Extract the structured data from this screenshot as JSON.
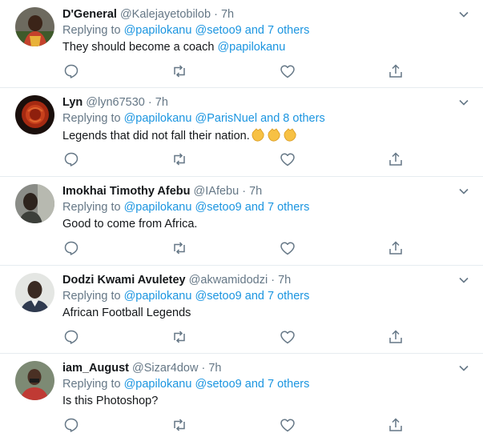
{
  "replying_label": "Replying to",
  "colors": {
    "link": "#1b95e0",
    "muted": "#657786",
    "text": "#14171a",
    "divider": "#e6ecf0"
  },
  "tweets": [
    {
      "name": "D'General",
      "handle": "@Kalejayetobilob",
      "dot": "·",
      "time": "7h",
      "reply_mention": "@papilokanu",
      "reply_rest": "@setoo9 and 7 others",
      "text": "They should become a coach",
      "text_mention": "@papilokanu"
    },
    {
      "name": "Lyn",
      "handle": "@lyn67530",
      "dot": "·",
      "time": "7h",
      "reply_mention": "@papilokanu",
      "reply_rest": "@ParisNuel and 8 others",
      "text": "Legends that did not fall their nation.",
      "emoji": "clapping-hands-icon ×3"
    },
    {
      "name": "Imokhai Timothy Afebu",
      "handle": "@IAfebu",
      "dot": "·",
      "time": "7h",
      "reply_mention": "@papilokanu",
      "reply_rest": "@setoo9 and 7 others",
      "text": "Good to come from Africa."
    },
    {
      "name": "Dodzi Kwami Avuletey",
      "handle": "@akwamidodzi",
      "dot": "·",
      "time": "7h",
      "reply_mention": "@papilokanu",
      "reply_rest": "@setoo9 and 7 others",
      "text": "African Football Legends"
    },
    {
      "name": "iam_August",
      "handle": "@Sizar4dow",
      "dot": "·",
      "time": "7h",
      "reply_mention": "@papilokanu",
      "reply_rest": "@setoo9 and 7 others",
      "text": "Is this Photoshop?"
    }
  ]
}
